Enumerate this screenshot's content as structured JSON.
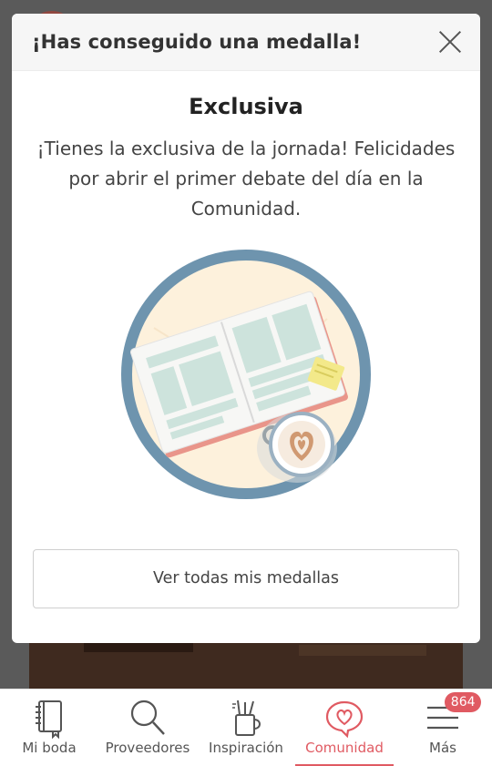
{
  "modal": {
    "title": "¡Has conseguido una medalla!",
    "medal_name": "Exclusiva",
    "description": "¡Tienes la exclusiva de la jornada! Felicidades por abrir el primer debate del día en la Comunidad.",
    "view_all_button": "Ver todas mis medallas"
  },
  "bottom_nav": {
    "items": [
      {
        "label": "Mi boda",
        "icon": "notebook-icon",
        "active": false
      },
      {
        "label": "Proveedores",
        "icon": "search-icon",
        "active": false
      },
      {
        "label": "Inspiración",
        "icon": "pencil-cup-icon",
        "active": false
      },
      {
        "label": "Comunidad",
        "icon": "heart-chat-icon",
        "active": true
      },
      {
        "label": "Más",
        "icon": "menu-icon",
        "active": false,
        "badge": "864"
      }
    ]
  },
  "colors": {
    "accent": "#e05a62",
    "medal_ring": "#6e94ae",
    "medal_fill": "#fdf1dc"
  }
}
